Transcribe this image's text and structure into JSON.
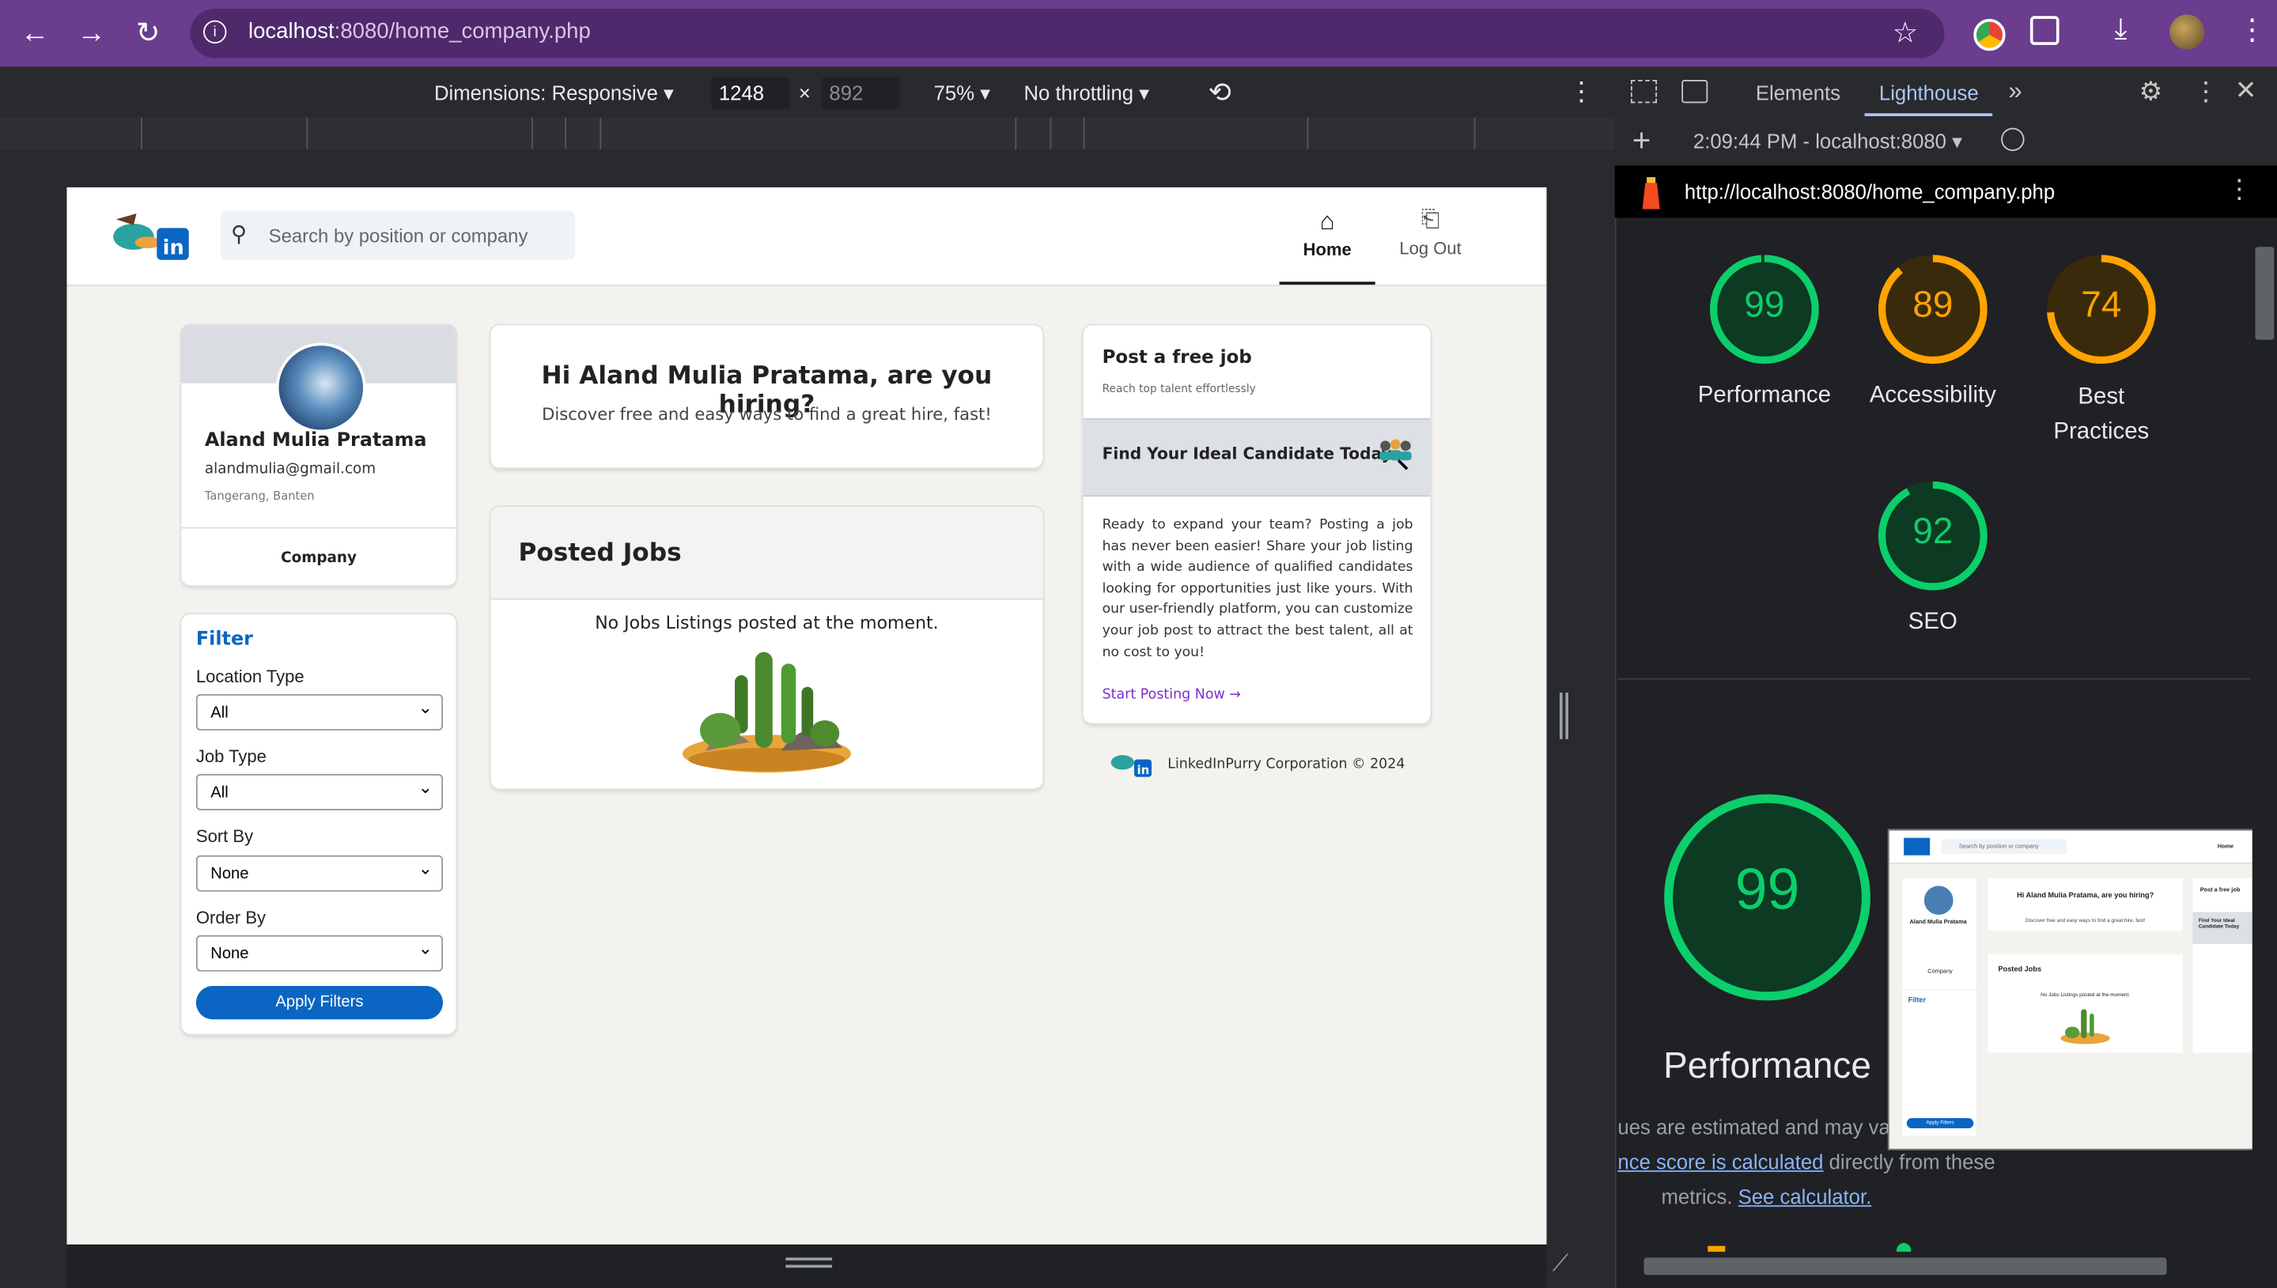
{
  "browser": {
    "url_host": "localhost",
    "url_path": ":8080/home_company.php"
  },
  "device_toolbar": {
    "dimensions_label": "Dimensions: Responsive",
    "width": "1248",
    "height": "892",
    "times": "×",
    "zoom": "75%",
    "throttling": "No throttling"
  },
  "header": {
    "search_placeholder": "Search by position or company",
    "home_label": "Home",
    "logout_label": "Log Out"
  },
  "profile": {
    "name": "Aland Mulia Pratama",
    "email": "alandmulia@gmail.com",
    "location": "Tangerang, Banten",
    "role": "Company"
  },
  "filter": {
    "title": "Filter",
    "location_type_label": "Location Type",
    "location_type_value": "All",
    "job_type_label": "Job Type",
    "job_type_value": "All",
    "sort_by_label": "Sort By",
    "sort_by_value": "None",
    "order_by_label": "Order By",
    "order_by_value": "None",
    "apply_label": "Apply Filters"
  },
  "greeting": {
    "title": "Hi Aland Mulia Pratama, are you hiring?",
    "subtitle": "Discover free and easy ways to find a great hire, fast!"
  },
  "posted_jobs": {
    "title": "Posted Jobs",
    "empty_text": "No Jobs Listings posted at the moment."
  },
  "post_job": {
    "title": "Post a free job",
    "subtitle": "Reach top talent effortlessly",
    "banner": "Find Your Ideal Candidate Today",
    "body": "Ready to expand your team? Posting a job has never been easier! Share your job listing with a wide audience of qualified candidates looking for opportunities just like yours. With our user-friendly platform, you can customize your job post to attract the best talent, all at no cost to you!",
    "cta": "Start Posting Now →"
  },
  "footer": {
    "text": "LinkedInPurry Corporation © 2024"
  },
  "devtools": {
    "tab_elements": "Elements",
    "tab_lighthouse": "Lighthouse",
    "report_time": "2:09:44 PM - localhost:8080",
    "report_url": "http://localhost:8080/home_company.php",
    "scores": [
      {
        "label": "Performance",
        "score": 99,
        "color": "#0cce6b"
      },
      {
        "label": "Accessibility",
        "score": 89,
        "color": "#ffa400"
      },
      {
        "label": "Best Practices",
        "score": 74,
        "color": "#ffa400"
      },
      {
        "label": "SEO",
        "score": 92,
        "color": "#0cce6b"
      }
    ],
    "big_score": 99,
    "big_label": "Performance",
    "desc_line1": "ues are estimated and may va",
    "desc_link1": "nce score is calculated",
    "desc_line2": " directly from these",
    "desc_line3": "metrics. ",
    "desc_link2": "See calculator."
  },
  "thumbnail": {
    "search": "Search by position or company",
    "home": "Home",
    "greeting": "Hi Aland Mulia Pratama, are you hiring?",
    "greeting_sub": "Discover free and easy ways to find a great hire, fast!",
    "posted_jobs": "Posted Jobs",
    "empty": "No Jobs Listings posted at the moment.",
    "post_job": "Post a free job",
    "banner": "Find Your Ideal Candidate Today",
    "name": "Aland Mulia Pratama",
    "company": "Company",
    "filter": "Filter",
    "apply": "Apply Filters"
  },
  "colors": {
    "browser_chrome": "#6a3d8f",
    "accent_blue": "#0a66c2",
    "link_purple": "#7b2fd0",
    "score_green": "#0cce6b",
    "score_orange": "#ffa400"
  }
}
